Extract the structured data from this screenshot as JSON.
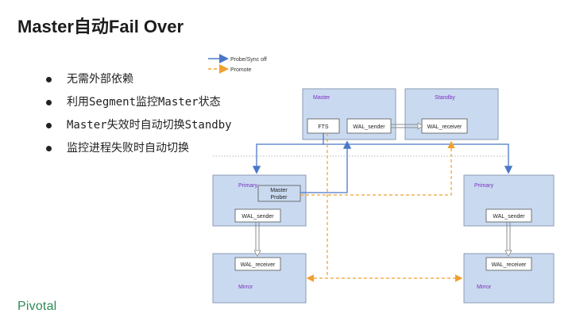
{
  "slide": {
    "title": "Master自动Fail Over",
    "bullets": [
      "无需外部依赖",
      "利用Segment监控Master状态",
      "Master失效时自动切换Standby",
      "监控进程失败时自动切换"
    ],
    "logo": "Pivotal"
  },
  "diagram": {
    "legend": {
      "probe": "Probe/Sync off",
      "promote": "Promote"
    },
    "nodes": {
      "master": {
        "title": "Master",
        "fts": "FTS",
        "wal_sender": "WAL_sender"
      },
      "standby": {
        "title": "Standby",
        "wal_receiver": "WAL_receiver"
      },
      "primary_left": {
        "title": "Primary",
        "prober_line1": "Master",
        "prober_line2": "Prober",
        "wal_sender": "WAL_sender"
      },
      "primary_right": {
        "title": "Primary",
        "wal_sender": "WAL_sender"
      },
      "mirror_left": {
        "title": "Mirror",
        "wal_receiver": "WAL_receiver"
      },
      "mirror_right": {
        "title": "Mirror",
        "wal_receiver": "WAL_receiver"
      }
    },
    "colors": {
      "box_fill": "#c9daf0",
      "box_border": "#8a9bb5",
      "title_purple": "#7b2fbe",
      "probe_blue": "#4a78c8",
      "promote_orange": "#f0a030",
      "sync_gray": "#8c8c8c"
    }
  }
}
